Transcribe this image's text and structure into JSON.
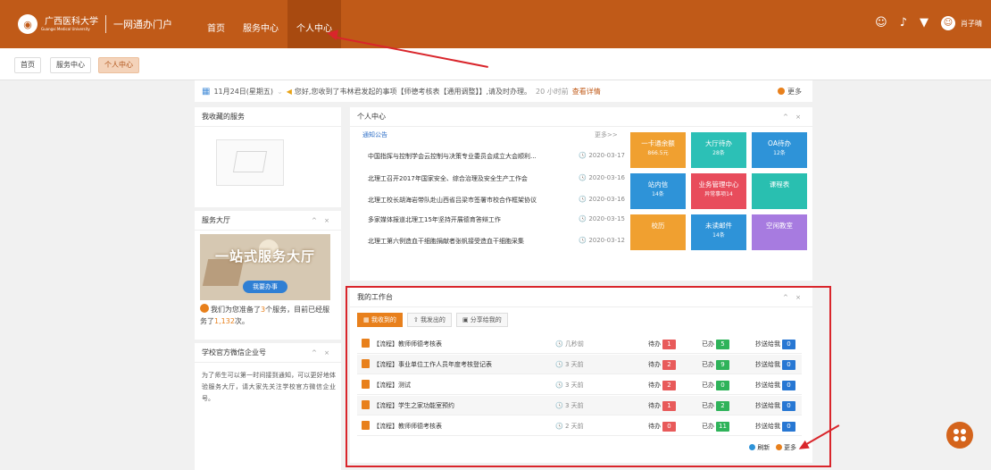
{
  "header": {
    "logo_text": "广西医科大学",
    "logo_sub": "Guangxi Medical University",
    "portal_title": "一网通办门户",
    "nav": [
      "首页",
      "服务中心",
      "个人中心"
    ],
    "user_name": "肖子晴"
  },
  "breadcrumbs": [
    "首页",
    "服务中心",
    "个人中心"
  ],
  "notice": {
    "date": "11月24日(星期五)",
    "message": "您好,您收到了韦林君发起的事项【师德考核表【通用调整】】,请及时办理。",
    "ago": "20 小时前",
    "link": "查看详情",
    "more": "更多"
  },
  "favorites": {
    "title": "我收藏的服务"
  },
  "service_hall": {
    "title": "服务大厅",
    "banner_title": "一站式服务大厅",
    "banner_button": "我要办事",
    "info_prefix": "我们为您准备了",
    "service_count": "3",
    "info_mid": "个服务，目前已经服务了",
    "served_count": "1,132",
    "info_suffix": "次。"
  },
  "wechat": {
    "title": "学校官方微信企业号",
    "text": "为了师生可以第一时间接到通知，可以更好地体验服务大厅，请大家先关注学校官方微信企业号。"
  },
  "personal": {
    "title": "个人中心",
    "sub_title": "通知公告",
    "more": "更多>>",
    "news": [
      {
        "title": "中国指挥与控制学会云控制与决策专业委员会成立大会顺利...",
        "date": "2020-03-17"
      },
      {
        "title": "北理工召开2017年国家安全、综合治理及安全生产工作会",
        "date": "2020-03-16"
      },
      {
        "title": "北理工校长胡海岩带队赴山西省吕梁市签署市校合作框架协议",
        "date": "2020-03-16"
      },
      {
        "title": "多家媒体报道北理工15年坚持开展德育答辩工作",
        "date": "2020-03-15"
      },
      {
        "title": "北理工第六例造血干细胞捐献者张帆接受造血干细胞采集",
        "date": "2020-03-12"
      }
    ],
    "tiles": [
      {
        "label": "一卡通余额",
        "sub": "866.5元",
        "color": "#f0a030"
      },
      {
        "label": "大厅待办",
        "sub": "28条",
        "color": "#2cc0b6"
      },
      {
        "label": "OA待办",
        "sub": "12条",
        "color": "#2e93d8"
      },
      {
        "label": "站内信",
        "sub": "14条",
        "color": "#2e93d8"
      },
      {
        "label": "业务管理中心",
        "sub": "异常事项14",
        "color": "#e84c5c"
      },
      {
        "label": "课程表",
        "sub": "",
        "color": "#29bfb0"
      },
      {
        "label": "校历",
        "sub": "",
        "color": "#f0a030"
      },
      {
        "label": "未读邮件",
        "sub": "14条",
        "color": "#2e93d8"
      },
      {
        "label": "空闲教室",
        "sub": "",
        "color": "#a77be0"
      }
    ]
  },
  "workbench": {
    "title": "我的工作台",
    "tabs": [
      "我收到的",
      "我发出的",
      "分享给我的"
    ],
    "pending_label": "待办",
    "done_label": "已办",
    "cc_label": "抄送给我",
    "rows": [
      {
        "title": "【流程】教师师德考核表",
        "time": "几秒前",
        "pending": "1",
        "done": "5",
        "cc": "0"
      },
      {
        "title": "【流程】事业单位工作人员年度考核登记表",
        "time": "3 天前",
        "pending": "2",
        "done": "9",
        "cc": "0"
      },
      {
        "title": "【流程】测试",
        "time": "3 天前",
        "pending": "2",
        "done": "0",
        "cc": "0"
      },
      {
        "title": "【流程】学生之家功能室预约",
        "time": "3 天前",
        "pending": "1",
        "done": "2",
        "cc": "0"
      },
      {
        "title": "【流程】教师师德考核表",
        "time": "2 天前",
        "pending": "0",
        "done": "11",
        "cc": "0"
      }
    ],
    "refresh": "刷新",
    "more": "更多"
  }
}
